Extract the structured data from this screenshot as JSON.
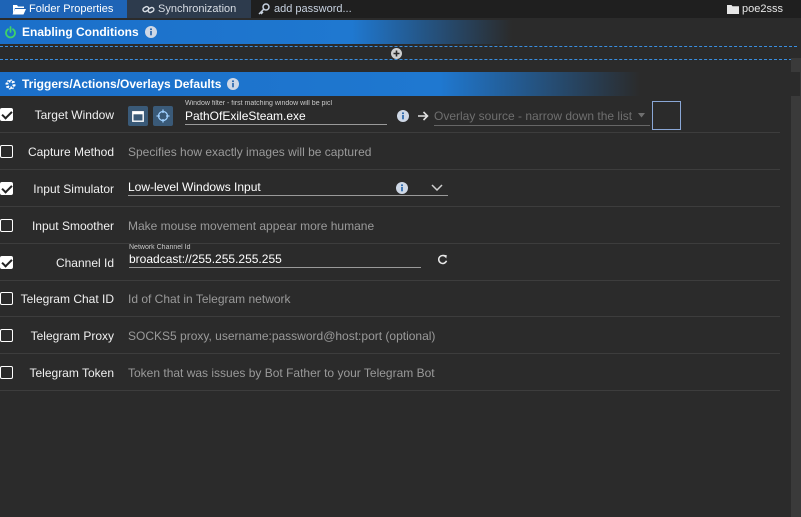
{
  "tabs": {
    "folder_properties": "Folder Properties",
    "synchronization": "Synchronization",
    "add_password": "add password..."
  },
  "profile": "poe2sss",
  "sections": {
    "enabling": "Enabling Conditions",
    "triggers": "Triggers/Actions/Overlays Defaults"
  },
  "rows": [
    {
      "label": "Target Window",
      "checked": true,
      "filter_hint": "Window filter - first matching window will be picl",
      "value": "PathOfExileSteam.exe",
      "overlay_placeholder": "Overlay source - narrow down the list"
    },
    {
      "label": "Capture Method",
      "checked": false,
      "placeholder": "Specifies how exactly images will be captured"
    },
    {
      "label": "Input Simulator",
      "checked": true,
      "value": "Low-level Windows Input"
    },
    {
      "label": "Input Smoother",
      "checked": false,
      "placeholder": "Make mouse movement appear more humane"
    },
    {
      "label": "Channel Id",
      "checked": true,
      "hint": "Network Channel Id",
      "value": "broadcast://255.255.255.255"
    },
    {
      "label": "Telegram Chat ID",
      "checked": false,
      "placeholder": "Id of Chat in Telegram network"
    },
    {
      "label": "Telegram Proxy",
      "checked": false,
      "placeholder": "SOCKS5 proxy, username:password@host:port (optional)"
    },
    {
      "label": "Telegram Token",
      "checked": false,
      "placeholder": "Token that was issues by Bot Father to your Telegram Bot"
    }
  ],
  "colors": {
    "accent": "#1e64b6",
    "section": "#1f78d0",
    "background": "#2b2b2b"
  }
}
